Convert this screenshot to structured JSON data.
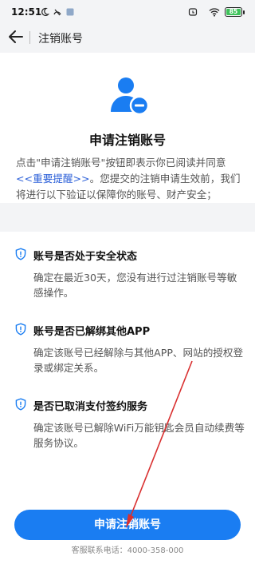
{
  "status_bar": {
    "time": "12:51",
    "battery": "85",
    "icons": [
      "moon-icon",
      "do-not-disturb-icon",
      "notification-icon",
      "alarm-icon",
      "wifi-icon",
      "battery-icon"
    ]
  },
  "nav": {
    "back_icon": "arrow-left-icon",
    "title": "注销账号"
  },
  "hero": {
    "icon": "user-remove-icon",
    "heading": "申请注销账号"
  },
  "notice": {
    "prefix": "点击\"申请注销账号\"按钮即表示你已阅读并同意 ",
    "link": "<<重要提醒>>",
    "suffix": "。您提交的注销申请生效前，我们将进行以下验证以保障你的账号、财产安全；"
  },
  "checks": [
    {
      "icon": "shield-check-icon",
      "title": "账号是否处于安全状态",
      "desc": "确定在最近30天，您没有进行过注销账号等敏感操作。"
    },
    {
      "icon": "shield-check-icon",
      "title": "账号是否已解绑其他APP",
      "desc": "确定该账号已经解除与其他APP、网站的授权登录或绑定关系。"
    },
    {
      "icon": "shield-check-icon",
      "title": "是否已取消支付签约服务",
      "desc": "确定该账号已解除WiFi万能钥匙会员自动续费等服务协议。"
    }
  ],
  "actions": {
    "submit_label": "申请注销账号",
    "hotline": "客服联系电话：4000-358-000"
  },
  "colors": {
    "accent": "#1a7df2",
    "link": "#2b5fd8",
    "annotation_arrow": "#d93030"
  }
}
